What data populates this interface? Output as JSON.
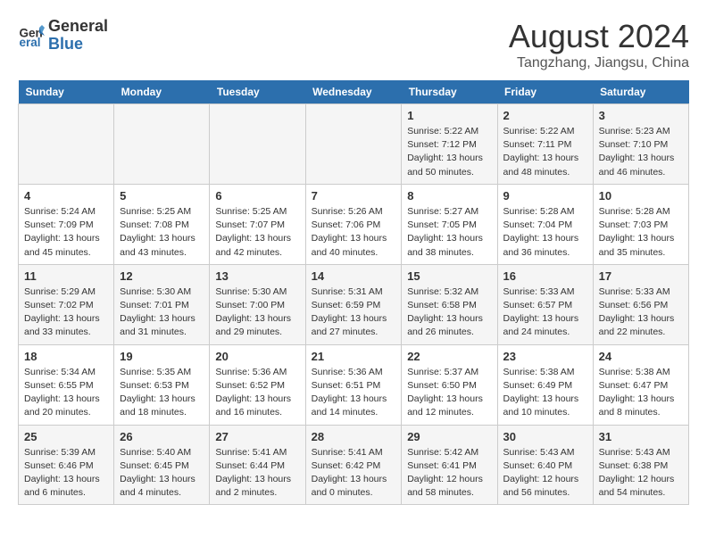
{
  "header": {
    "logo_line1": "General",
    "logo_line2": "Blue",
    "month_title": "August 2024",
    "subtitle": "Tangzhang, Jiangsu, China"
  },
  "days_of_week": [
    "Sunday",
    "Monday",
    "Tuesday",
    "Wednesday",
    "Thursday",
    "Friday",
    "Saturday"
  ],
  "weeks": [
    [
      {
        "day": "",
        "info": ""
      },
      {
        "day": "",
        "info": ""
      },
      {
        "day": "",
        "info": ""
      },
      {
        "day": "",
        "info": ""
      },
      {
        "day": "1",
        "info": "Sunrise: 5:22 AM\nSunset: 7:12 PM\nDaylight: 13 hours\nand 50 minutes."
      },
      {
        "day": "2",
        "info": "Sunrise: 5:22 AM\nSunset: 7:11 PM\nDaylight: 13 hours\nand 48 minutes."
      },
      {
        "day": "3",
        "info": "Sunrise: 5:23 AM\nSunset: 7:10 PM\nDaylight: 13 hours\nand 46 minutes."
      }
    ],
    [
      {
        "day": "4",
        "info": "Sunrise: 5:24 AM\nSunset: 7:09 PM\nDaylight: 13 hours\nand 45 minutes."
      },
      {
        "day": "5",
        "info": "Sunrise: 5:25 AM\nSunset: 7:08 PM\nDaylight: 13 hours\nand 43 minutes."
      },
      {
        "day": "6",
        "info": "Sunrise: 5:25 AM\nSunset: 7:07 PM\nDaylight: 13 hours\nand 42 minutes."
      },
      {
        "day": "7",
        "info": "Sunrise: 5:26 AM\nSunset: 7:06 PM\nDaylight: 13 hours\nand 40 minutes."
      },
      {
        "day": "8",
        "info": "Sunrise: 5:27 AM\nSunset: 7:05 PM\nDaylight: 13 hours\nand 38 minutes."
      },
      {
        "day": "9",
        "info": "Sunrise: 5:28 AM\nSunset: 7:04 PM\nDaylight: 13 hours\nand 36 minutes."
      },
      {
        "day": "10",
        "info": "Sunrise: 5:28 AM\nSunset: 7:03 PM\nDaylight: 13 hours\nand 35 minutes."
      }
    ],
    [
      {
        "day": "11",
        "info": "Sunrise: 5:29 AM\nSunset: 7:02 PM\nDaylight: 13 hours\nand 33 minutes."
      },
      {
        "day": "12",
        "info": "Sunrise: 5:30 AM\nSunset: 7:01 PM\nDaylight: 13 hours\nand 31 minutes."
      },
      {
        "day": "13",
        "info": "Sunrise: 5:30 AM\nSunset: 7:00 PM\nDaylight: 13 hours\nand 29 minutes."
      },
      {
        "day": "14",
        "info": "Sunrise: 5:31 AM\nSunset: 6:59 PM\nDaylight: 13 hours\nand 27 minutes."
      },
      {
        "day": "15",
        "info": "Sunrise: 5:32 AM\nSunset: 6:58 PM\nDaylight: 13 hours\nand 26 minutes."
      },
      {
        "day": "16",
        "info": "Sunrise: 5:33 AM\nSunset: 6:57 PM\nDaylight: 13 hours\nand 24 minutes."
      },
      {
        "day": "17",
        "info": "Sunrise: 5:33 AM\nSunset: 6:56 PM\nDaylight: 13 hours\nand 22 minutes."
      }
    ],
    [
      {
        "day": "18",
        "info": "Sunrise: 5:34 AM\nSunset: 6:55 PM\nDaylight: 13 hours\nand 20 minutes."
      },
      {
        "day": "19",
        "info": "Sunrise: 5:35 AM\nSunset: 6:53 PM\nDaylight: 13 hours\nand 18 minutes."
      },
      {
        "day": "20",
        "info": "Sunrise: 5:36 AM\nSunset: 6:52 PM\nDaylight: 13 hours\nand 16 minutes."
      },
      {
        "day": "21",
        "info": "Sunrise: 5:36 AM\nSunset: 6:51 PM\nDaylight: 13 hours\nand 14 minutes."
      },
      {
        "day": "22",
        "info": "Sunrise: 5:37 AM\nSunset: 6:50 PM\nDaylight: 13 hours\nand 12 minutes."
      },
      {
        "day": "23",
        "info": "Sunrise: 5:38 AM\nSunset: 6:49 PM\nDaylight: 13 hours\nand 10 minutes."
      },
      {
        "day": "24",
        "info": "Sunrise: 5:38 AM\nSunset: 6:47 PM\nDaylight: 13 hours\nand 8 minutes."
      }
    ],
    [
      {
        "day": "25",
        "info": "Sunrise: 5:39 AM\nSunset: 6:46 PM\nDaylight: 13 hours\nand 6 minutes."
      },
      {
        "day": "26",
        "info": "Sunrise: 5:40 AM\nSunset: 6:45 PM\nDaylight: 13 hours\nand 4 minutes."
      },
      {
        "day": "27",
        "info": "Sunrise: 5:41 AM\nSunset: 6:44 PM\nDaylight: 13 hours\nand 2 minutes."
      },
      {
        "day": "28",
        "info": "Sunrise: 5:41 AM\nSunset: 6:42 PM\nDaylight: 13 hours\nand 0 minutes."
      },
      {
        "day": "29",
        "info": "Sunrise: 5:42 AM\nSunset: 6:41 PM\nDaylight: 12 hours\nand 58 minutes."
      },
      {
        "day": "30",
        "info": "Sunrise: 5:43 AM\nSunset: 6:40 PM\nDaylight: 12 hours\nand 56 minutes."
      },
      {
        "day": "31",
        "info": "Sunrise: 5:43 AM\nSunset: 6:38 PM\nDaylight: 12 hours\nand 54 minutes."
      }
    ]
  ]
}
